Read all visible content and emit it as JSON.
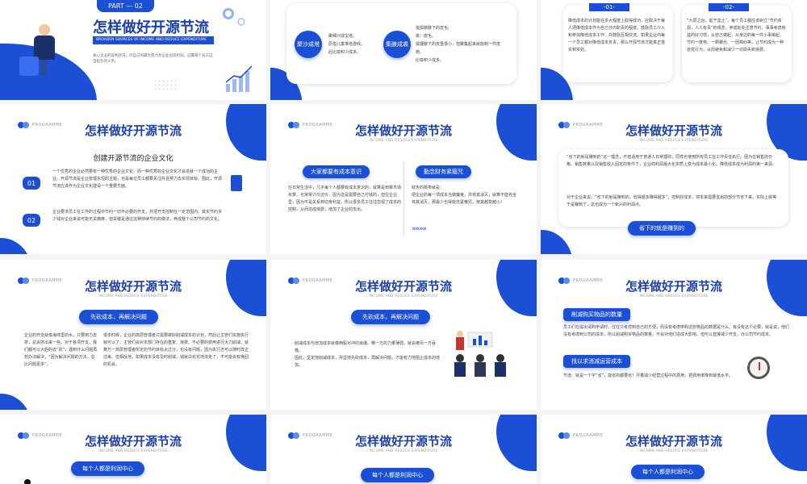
{
  "s1": {
    "part": "PART — 02",
    "title": "怎样做好开源节流",
    "en": "BROADEN SOURCES OF INCOME AND REDUCE EXPENDITURE",
    "desc": "关心企业的盈利状况，尽自己的最大努力为企业创造利润，这最每个员工应当担负的义务。"
  },
  "s2": {
    "left_badge": "聚沙成塔",
    "left_items": [
      "聚细沙成宝塔。",
      "原指儿童堆塔游戏。",
      "后比喻积少成多。"
    ],
    "right_badge": "集腋成裘",
    "right_items": [
      "指狐腋腋下的皮毛;",
      "裘：皮毛。",
      "狐狸腋下的皮虽很小，但聚集起来就能制一件皮袍。",
      "比喻积少成多。"
    ]
  },
  "s3": {
    "tag1": "-01-",
    "text1": "降低成本的计划能在多大程度上取得成功，应取决于每人把降低成本作为自己分内职责的程度。鼓励员工介入和参加降低成本工作、并鼓励互相交流。如果企业内每一个员工都对降低成本负责，那么开源节流才能真正落实到实处。",
    "tag2": "-02-",
    "text2": "“九层之台，起于垒土”，每个员工都应该树立“节约资源，人人有责”的观念，养成处处注意节约、事事考虑效益的好习惯，从自己做起，从身边的每一件小事做起。节约一度电、一颗螺丝、一团棉纱等，让节约成为一种自觉行为，从而避免和减少一切损失和浪费。"
  },
  "common": {
    "logo": "PROGRAMME",
    "title": "怎样做好开源节流",
    "en": "INCOME AND REDUCE EXPENDITURE"
  },
  "s4": {
    "heading": "创建开源节流的企业文化",
    "n1": "01",
    "t1": "一个优秀的企业必然要有一种优秀的企业文化，而一种优秀的企业文化才会造就一个成功的企业。开源节流是企业管理永恒的主题，也是每位员工都要关注并且努力去实现目标。因此，开源节流应该作为企业文化建设一个重要方面。",
    "n2": "02",
    "t2": "企业要求员工在工作的过程中节约一切不必要的开支，并把开支控制在一定范围内。其实节约多少钱对企业来说可能无关痛痒，但关键是通过这种持续节约的做法，养成整个公司节约的文化。"
  },
  "s5": {
    "left_title": "大家都要有成本意识",
    "left_text": "在日常生活中，几乎每个人都要有成本意识的，就算是到菜市场买菜，也常常讨价还价，因为这是需要自己付钱的，但在企业里，因为不是关系到切身利益，所以很多员工往往忽视了成本的控制，从而造成浪费，增加了企业的支出。",
    "right_title": "勤念财务紧箍咒",
    "right_text": "财务的那类就是：\n  把企业的每一项成本当做魔鬼，并将其消灭；就算不能完全将其消灭，那最少也得能念紧箍咒，使其越变越小！",
    "arrows": "»»»»"
  },
  "s6": {
    "quote": "“省下的就是赚到的”这一理念，不但适用于普通人日常理财，同样也使用所有员工在工作责任执行。因为在销售的价格、销售数量以及销售收入固定的条件下，企业的利润最大化实质上变为成本最小化。降低成本成为利润的第一来源。",
    "quote2": "对于企业来说，“省下的就是赚到的，省得越多赚得越多”，控制好成本，将本来需要支出的部分节省下来，实际上就等于是赚到了，这也成为一个新兴的利润点。",
    "pill": "省下的就是赚到的"
  },
  "s7": {
    "pill": "先砍成本，再解决问题",
    "left_text": "企业的开支就像海绵里的水，只要用力去挤，总会挤出来一些。对于各项开支，我们都可以大胆的去“砍”，遇到什么问题再想办法解决，“因为解决问题的方法，总比问题更多”。",
    "right_text": "很多时候，企业的高层管理者只需要做好削减成本的计划，然后让主管们实施执行就可以了。主管们会对本部门存在的重复、浪费、不必要的费用进行大力削减。就算万一高层管理者所定的节约目标太过分，也没有问题，因为执行还可以随时改正过来。但相反地，如果成本没有及时削减，钱就白花花地流走了，不可能会有挽回的机会。"
  },
  "s8": {
    "pill": "先砍成本，再解决问题",
    "text": "削减成本与增加成本就像两股对冲的浪潮。哪一方的力量薄弱，就会被另一方吞噬。\n因此，坚定地削减成本，并坚持先砍成本，再解决问题，才能有力地阻止成本的增加。"
  },
  "s9": {
    "pill1": "削减购买物品的数量",
    "text1": "员工们在提出请购申请时，往往只考虑到自己的方便，而没有考虑申购这些物品的数据是什么。有没有这个必要，就是说，他们没有考虑到公司的成本，所以削减购买物品的数量，不会对他们造成大影响。但可以直接减少开支，办公司节约成本。",
    "pill2": "找以求消减运营成本",
    "text2": "节流：就是一个字“省”，能省的都要省！尽量减少经营过程中的费用，把费用率降到最低水平。"
  },
  "s10": {
    "pill": "每个人都是利润中心"
  },
  "s11": {
    "pill": "每个人都是利润中心"
  },
  "s12": {
    "pill": "每个人都是利润中心"
  }
}
